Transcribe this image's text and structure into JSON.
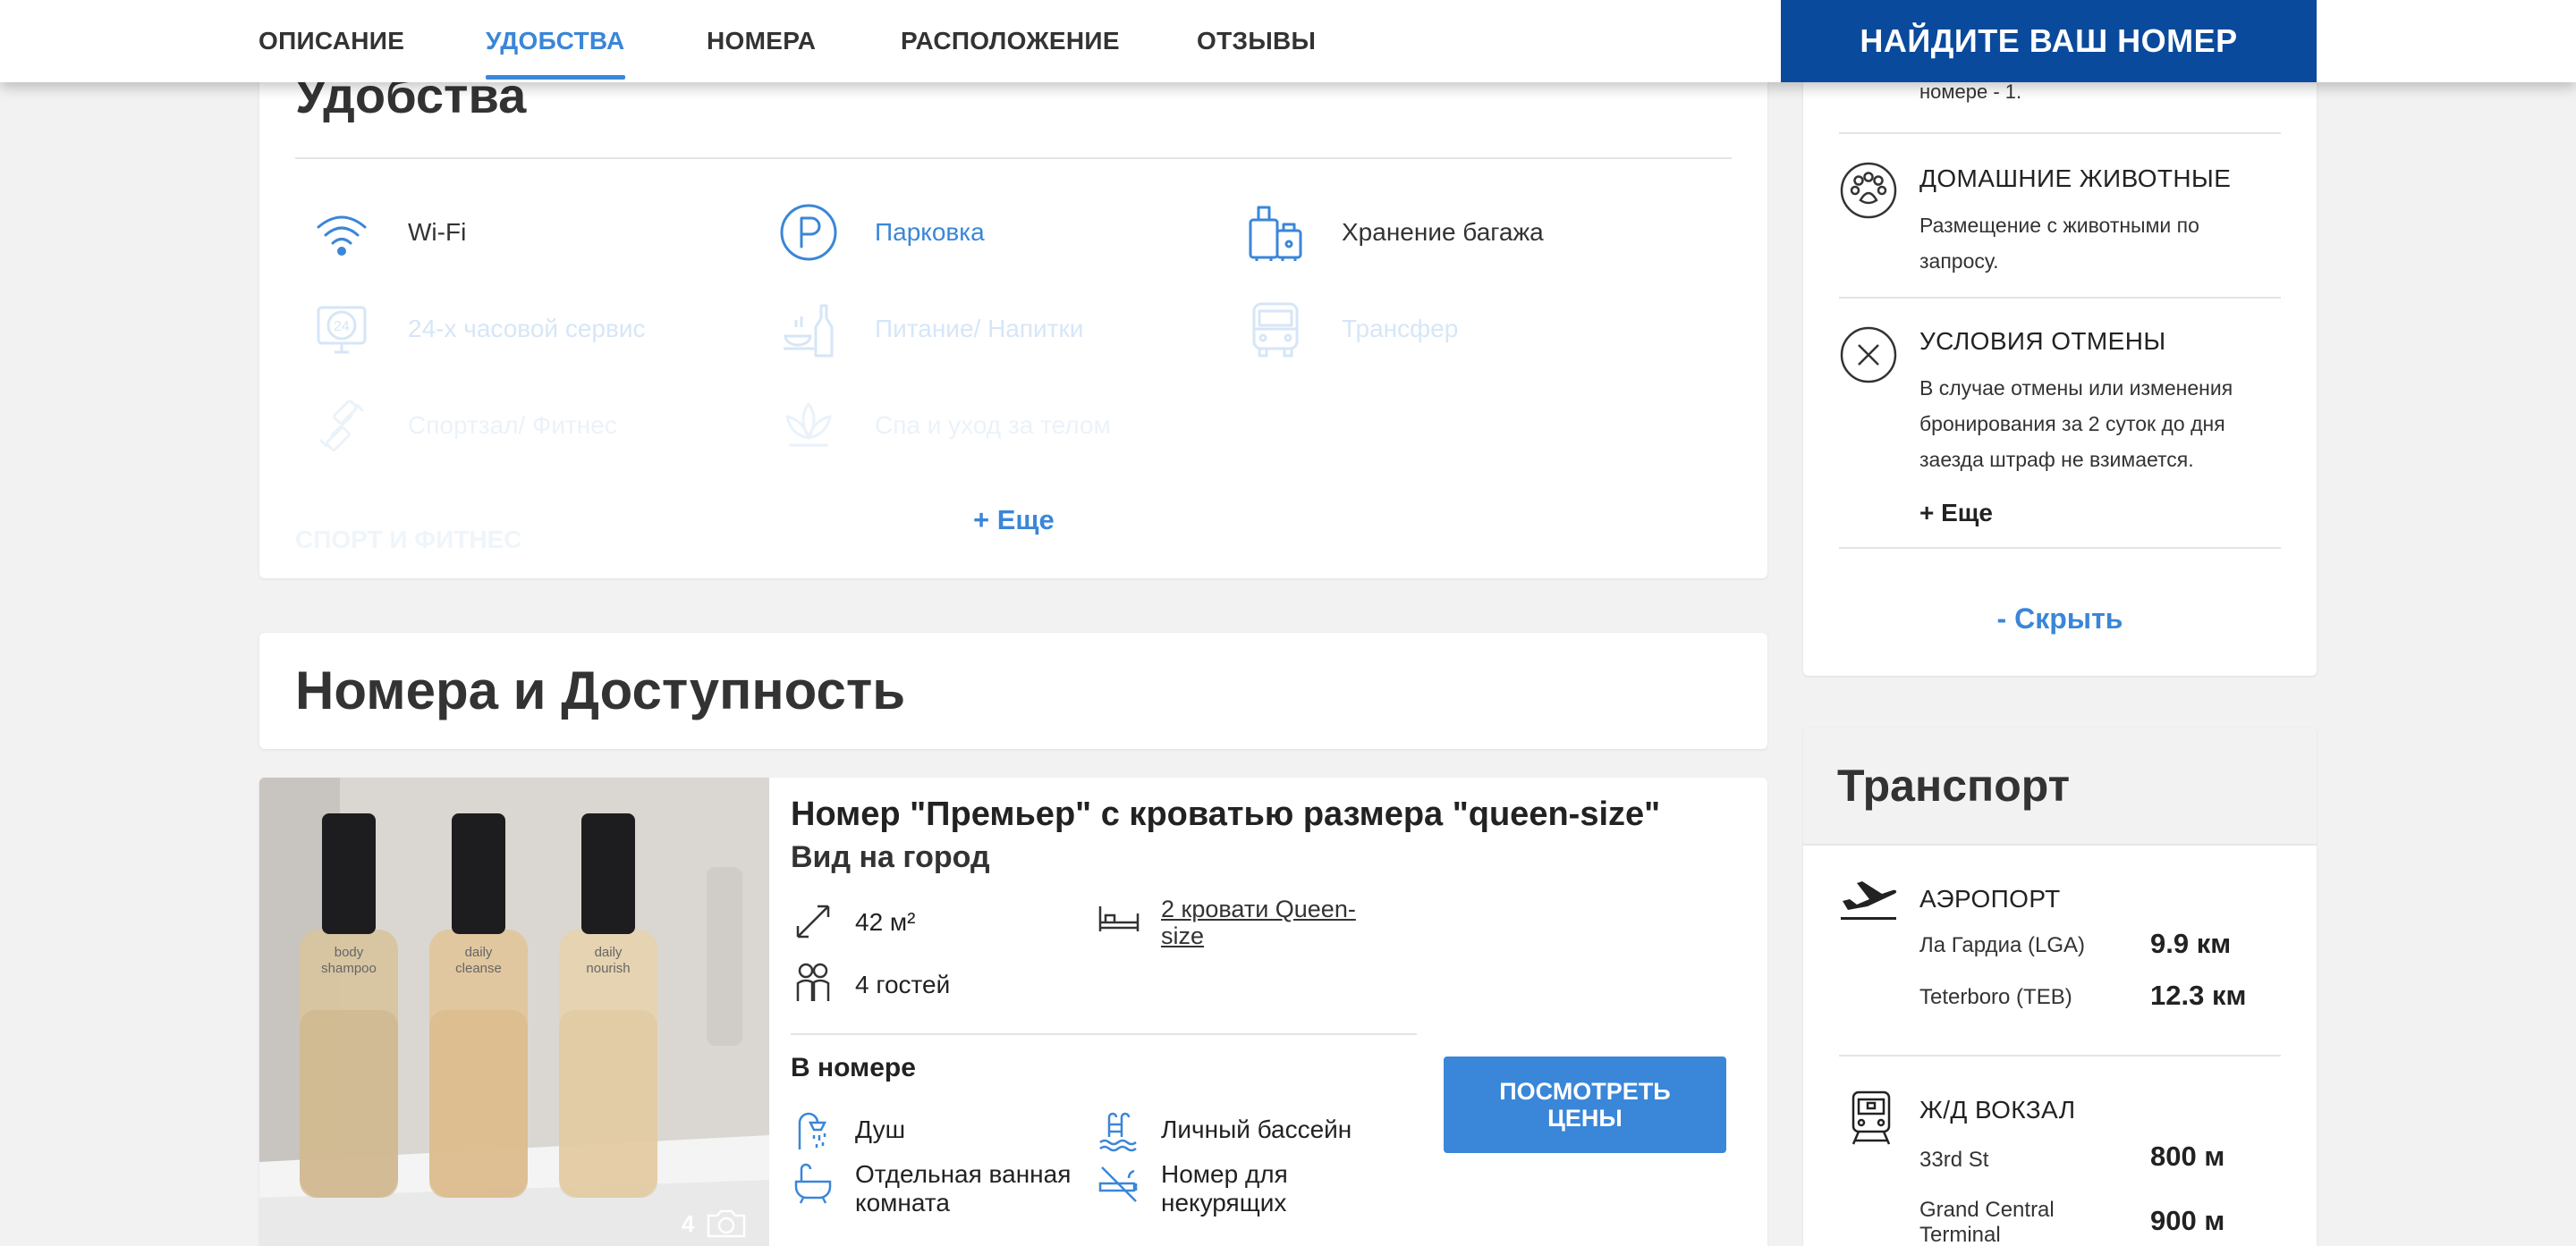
{
  "nav": {
    "tabs": [
      {
        "label": "ОПИСАНИЕ"
      },
      {
        "label": "УДОБСТВА"
      },
      {
        "label": "НОМЕРА"
      },
      {
        "label": "РАСПОЛОЖЕНИЕ"
      },
      {
        "label": "ОТЗЫВЫ"
      }
    ],
    "active_tab": "УДОБСТВА",
    "cta": "НАЙДИТЕ ВАШ НОМЕР"
  },
  "amenities": {
    "title": "Удобства",
    "items": [
      {
        "label": "Wi-Fi",
        "icon": "wifi-icon"
      },
      {
        "label": "Парковка",
        "icon": "parking-icon"
      },
      {
        "label": "Хранение багажа",
        "icon": "luggage-icon"
      },
      {
        "label": "24-х часовой сервис",
        "icon": "clock-24-icon"
      },
      {
        "label": "Питание/ Напитки",
        "icon": "food-drink-icon"
      },
      {
        "label": "Трансфер",
        "icon": "bus-icon"
      },
      {
        "label": "Спортзал/ Фитнес",
        "icon": "dumbbell-icon"
      },
      {
        "label": "Спа и уход за телом",
        "icon": "lotus-icon"
      }
    ],
    "section_hint": "СПОРТ И ФИТНЕС",
    "more": "+ Еще"
  },
  "rooms_section": {
    "title": "Номера и Доступность"
  },
  "room": {
    "name": "Номер \"Премьер\" с кроватью размера \"queen-size\"",
    "view": "Вид на город",
    "area": "42 м²",
    "guests": "4 гостей",
    "beds": "2 кровати Queen-size",
    "in_room_title": "В номере",
    "features": [
      "Душ",
      "Личный бассейн",
      "Отдельная ванная комната",
      "Номер для некурящих"
    ],
    "photo_count": "4",
    "cta": "ПОСМОТРЕТЬ ЦЕНЫ"
  },
  "policies": {
    "top_text": "номере - 1.",
    "pets_title": "ДОМАШНИЕ ЖИВОТНЫЕ",
    "pets_text": "Размещение с животными по запросу.",
    "cancel_title": "УСЛОВИЯ ОТМЕНЫ",
    "cancel_text": "В случае отмены или изменения бронирования за 2 суток до дня заезда штраф не взимается.",
    "more": "+ Еще",
    "hide": "- Скрыть"
  },
  "transport": {
    "title": "Транспорт",
    "airport_title": "АЭРОПОРТ",
    "airports": [
      {
        "name": "Ла Гардиа (LGA)",
        "distance": "9.9 км"
      },
      {
        "name": "Teterboro (TEB)",
        "distance": "12.3 км"
      }
    ],
    "rail_title": "Ж/Д ВОКЗАЛ",
    "stations": [
      {
        "name": "33rd St",
        "distance": "800 м"
      },
      {
        "name": "Grand Central Terminal",
        "distance": "900 м"
      }
    ]
  },
  "colors": {
    "accent": "#3a86d8",
    "navy": "#0a4a9c",
    "background": "#f2f2f2"
  }
}
